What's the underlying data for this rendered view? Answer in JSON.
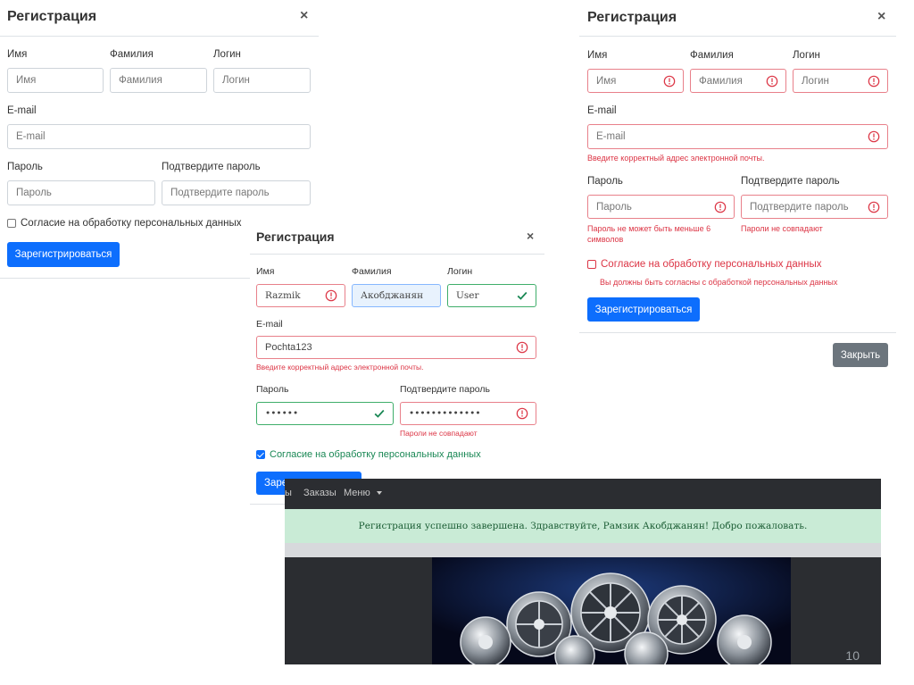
{
  "modal_a": {
    "title": "Регистрация",
    "close": "×",
    "labels": {
      "first_name": "Имя",
      "last_name": "Фамилия",
      "login": "Логин",
      "email": "E-mail",
      "password": "Пароль",
      "confirm": "Подтвердите пароль"
    },
    "placeholders": {
      "first_name": "Имя",
      "last_name": "Фамилия",
      "login": "Логин",
      "email": "E-mail",
      "password": "Пароль",
      "confirm": "Подтвердите пароль"
    },
    "consent": "Согласие на обработку персональных данных",
    "submit": "Зарегистрироваться"
  },
  "modal_b": {
    "title": "Регистрация",
    "close": "×",
    "labels": {
      "first_name": "Имя",
      "last_name": "Фамилия",
      "login": "Логин",
      "email": "E-mail",
      "password": "Пароль",
      "confirm": "Подтвердите пароль"
    },
    "placeholders": {
      "first_name": "Имя",
      "last_name": "Фамилия",
      "login": "Логин",
      "email": "E-mail",
      "password": "Пароль",
      "confirm": "Подтвердите пароль"
    },
    "errors": {
      "email": "Введите корректный адрес электронной почты.",
      "password": "Пароль не может быть меньше 6 символов",
      "confirm": "Пароли не совпадают",
      "consent": "Вы должны быть согласны с обработкой персональных данных"
    },
    "consent": "Согласие на обработку персональных данных",
    "submit": "Зарегистрироваться",
    "close_button": "Закрыть"
  },
  "modal_c": {
    "title": "Регистрация",
    "close": "×",
    "labels": {
      "first_name": "Имя",
      "last_name": "Фамилия",
      "login": "Логин",
      "email": "E-mail",
      "password": "Пароль",
      "confirm": "Подтвердите пароль"
    },
    "values": {
      "first_name": "Razmik",
      "last_name": "Акобджанян",
      "login": "User",
      "email": "Pochta123",
      "password": "••••••",
      "confirm": "•••••••••••••"
    },
    "errors": {
      "email": "Введите корректный адрес электронной почты.",
      "confirm": "Пароли не совпадают"
    },
    "consent": "Согласие на обработку персональных данных",
    "submit": "Зарегистрироваться"
  },
  "site": {
    "nav": {
      "partial_item": "ы",
      "orders": "Заказы",
      "menu": "Меню"
    },
    "alert": "Регистрация успешно завершена. Здравствуйте, Рамзик Акобджанян! Добро пожаловать.",
    "hero_alt": ""
  },
  "slide_number": "10",
  "colors": {
    "primary": "#0d6efd",
    "danger": "#dc3545",
    "success": "#198754",
    "secondary": "#6c757d"
  }
}
